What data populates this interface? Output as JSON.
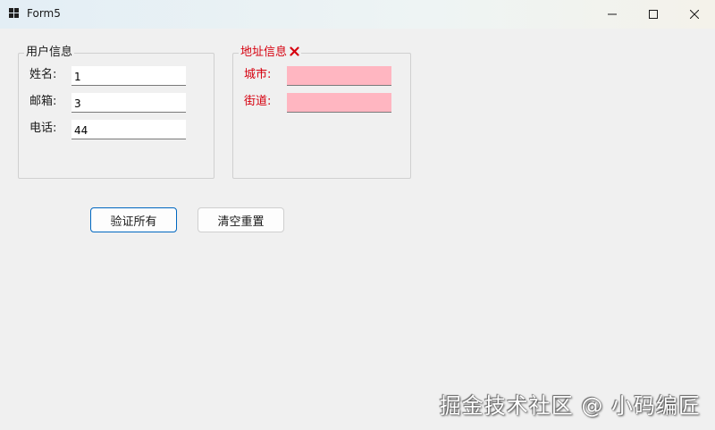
{
  "window": {
    "title": "Form5",
    "icon": "app-windows-icon",
    "controls": [
      "minimize-icon",
      "maximize-icon",
      "close-icon"
    ]
  },
  "user_group": {
    "title": "用户信息",
    "fields": [
      {
        "label": "姓名:",
        "value": "1"
      },
      {
        "label": "邮箱:",
        "value": "3"
      },
      {
        "label": "电话:",
        "value": "44"
      }
    ]
  },
  "address_group": {
    "title": "地址信息",
    "error_icon": "error-x-icon",
    "fields": [
      {
        "label": "城市:",
        "value": ""
      },
      {
        "label": "街道:",
        "value": ""
      }
    ]
  },
  "buttons": {
    "validate_all": "验证所有",
    "clear_reset": "清空重置"
  },
  "watermark": "掘金技术社区 @ 小码编匠",
  "colors": {
    "error_text": "#d6000f",
    "invalid_field_bg": "#ffb6c1",
    "default_button_border": "#0067c0",
    "form_bg": "#f0f0f0"
  }
}
